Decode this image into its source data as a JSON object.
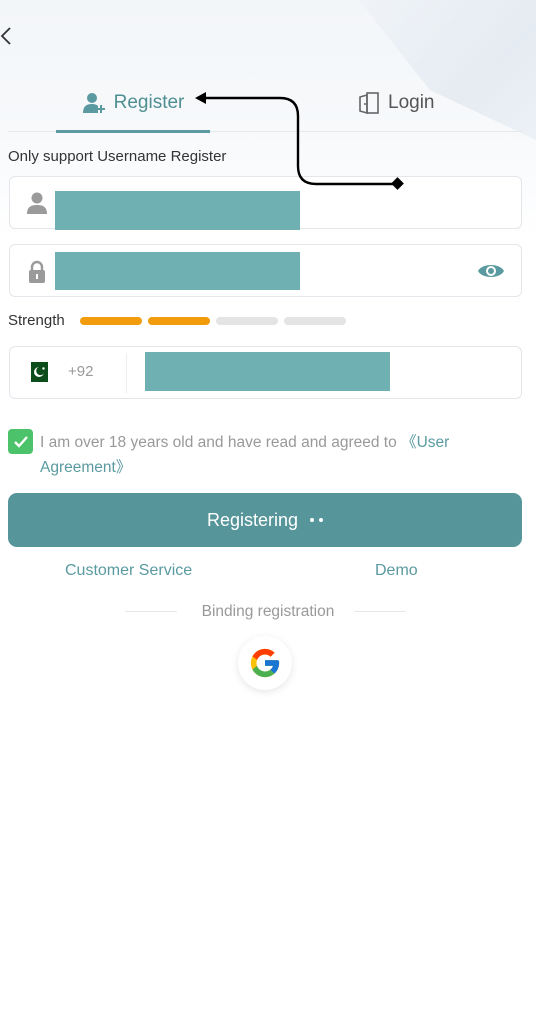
{
  "tabs": {
    "register": "Register",
    "login": "Login"
  },
  "hint": "Only support Username Register",
  "strength": {
    "label": "Strength",
    "level": 2,
    "total": 4,
    "active_color": "#f29b0b",
    "inactive_color": "#e4e4e4"
  },
  "phone": {
    "country_code": "+92"
  },
  "agreement": {
    "text": "I am over 18 years old and have read and agreed to",
    "link": "《User Agreement》",
    "checked": true
  },
  "submit": {
    "label": "Registering"
  },
  "links": {
    "customer_service": "Customer Service",
    "demo": "Demo"
  },
  "binding": {
    "label": "Binding registration"
  },
  "colors": {
    "accent": "#5a9aa0",
    "button": "#56959a",
    "check": "#4cc36a"
  },
  "icons": [
    "back-icon",
    "user-add-icon",
    "door-icon",
    "person-icon",
    "lock-icon",
    "eye-icon",
    "pakistan-flag-icon",
    "check-icon",
    "google-icon"
  ]
}
